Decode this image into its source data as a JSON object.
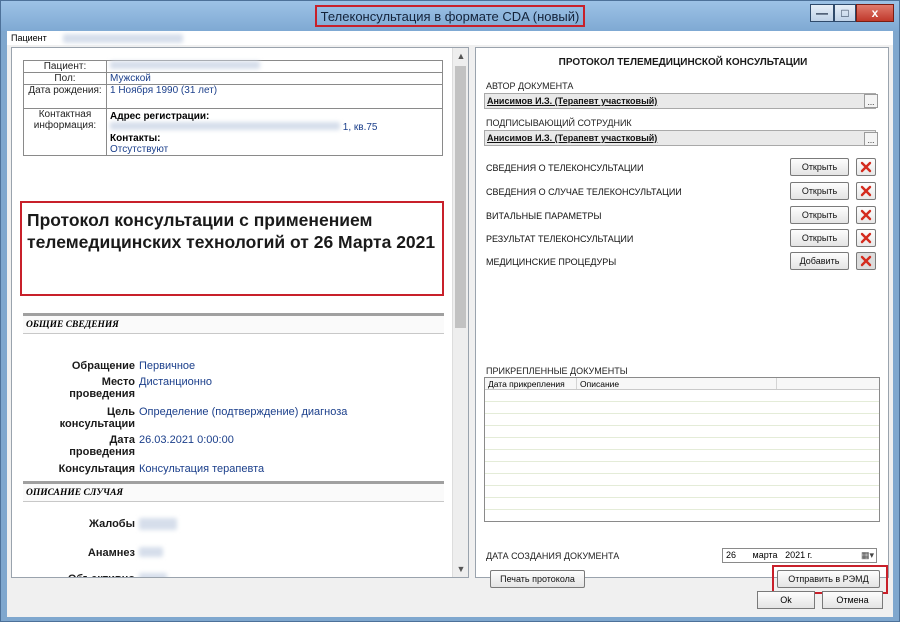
{
  "window": {
    "title": "Телеконсультация в формате CDA (новый)",
    "controls": {
      "minimize": "—",
      "maximize": "□",
      "close": "x"
    }
  },
  "patient_strip": {
    "label": "Пациент"
  },
  "patient_info": [
    {
      "key": "Пациент:",
      "value": ""
    },
    {
      "key": "Пол:",
      "value": "Мужской"
    },
    {
      "key": "Дата рождения:",
      "value": "1 Ноября 1990 (31 лет)"
    }
  ],
  "contact": {
    "key": "Контактная информация:",
    "address_label": "Адрес регистрации:",
    "address_value": "1, кв.75",
    "contacts_label": "Контакты:",
    "contacts_value": "Отсутствуют"
  },
  "document_title": "Протокол консультации с применением телемедицинских технологий от 26 Марта 2021",
  "general": {
    "section_title": "ОБЩИЕ СВЕДЕНИЯ",
    "rows": [
      {
        "key": "Обращение",
        "value": "Первичное"
      },
      {
        "key": "Место проведения",
        "value": "Дистанционно"
      },
      {
        "key": "Цель консультации",
        "value": "Определение (подтверждение) диагноза"
      },
      {
        "key": "Дата проведения",
        "value": "26.03.2021 0:00:00"
      },
      {
        "key": "Консультация",
        "value": "Консультация терапевта"
      }
    ]
  },
  "case": {
    "section_title": "ОПИСАНИЕ СЛУЧАЯ",
    "rows": [
      {
        "key": "Жалобы"
      },
      {
        "key": "Анамнез"
      },
      {
        "key": "Объективно"
      }
    ]
  },
  "protocol": {
    "heading": "ПРОТОКОЛ ТЕЛЕМЕДИЦИНСКОЙ КОНСУЛЬТАЦИИ",
    "author_label": "АВТОР ДОКУМЕНТА",
    "author_value": "Анисимов И.З. (Терапевт участковый)",
    "signer_label": "ПОДПИСЫВАЮЩИЙ СОТРУДНИК",
    "signer_value": "Анисимов И.З. (Терапевт участковый)",
    "ellipsis": "...",
    "sections": [
      {
        "label": "СВЕДЕНИЯ О ТЕЛЕКОНСУЛЬТАЦИИ",
        "button": "Открыть"
      },
      {
        "label": "СВЕДЕНИЯ О СЛУЧАЕ ТЕЛЕКОНСУЛЬТАЦИИ",
        "button": "Открыть"
      },
      {
        "label": "ВИТАЛЬНЫЕ ПАРАМЕТРЫ",
        "button": "Открыть"
      },
      {
        "label": "РЕЗУЛЬТАТ ТЕЛЕКОНСУЛЬТАЦИИ",
        "button": "Открыть"
      },
      {
        "label": "МЕДИЦИНСКИЕ ПРОЦЕДУРЫ",
        "button": "Добавить"
      }
    ],
    "attached_label": "ПРИКРЕПЛЕННЫЕ ДОКУМЕНТЫ",
    "attached_columns": [
      "Дата прикрепления",
      "Описание"
    ],
    "creation_date_label": "ДАТА СОЗДАНИЯ ДОКУМЕНТА",
    "creation_date": {
      "day": "26",
      "month": "марта",
      "year": "2021 г."
    },
    "print_button": "Печать протокола",
    "send_button": "Отправить в РЭМД"
  },
  "footer": {
    "ok": "Ok",
    "cancel": "Отмена"
  },
  "colors": {
    "highlight": "#c8202a",
    "value_text": "#1b3f8b",
    "title_bar": "#8db4dc"
  }
}
